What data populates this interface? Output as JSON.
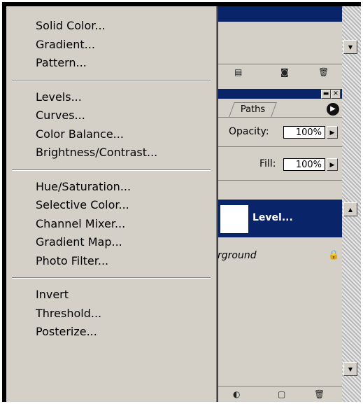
{
  "menu": {
    "groups": [
      [
        "Solid Color...",
        "Gradient...",
        "Pattern..."
      ],
      [
        "Levels...",
        "Curves...",
        "Color Balance...",
        "Brightness/Contrast..."
      ],
      [
        "Hue/Saturation...",
        "Selective Color...",
        "Channel Mixer...",
        "Gradient Map...",
        "Photo Filter..."
      ],
      [
        "Invert",
        "Threshold...",
        "Posterize..."
      ]
    ]
  },
  "layers_panel": {
    "tab_paths": "Paths",
    "opacity_label": "Opacity:",
    "opacity_value": "100%",
    "fill_label": "Fill:",
    "fill_value": "100%",
    "selected_layer": "Level...",
    "background_layer": "rground"
  },
  "icons": {
    "scroll_up": "scroll-up-arrow",
    "scroll_down": "scroll-down-arrow",
    "trash": "trash-icon",
    "lock": "lock-icon",
    "panel_menu": "panel-menu-icon"
  },
  "colors": {
    "title_bar": "#0a246a",
    "menu_bg": "#d4d0c8",
    "selected_row": "#0a246a"
  }
}
